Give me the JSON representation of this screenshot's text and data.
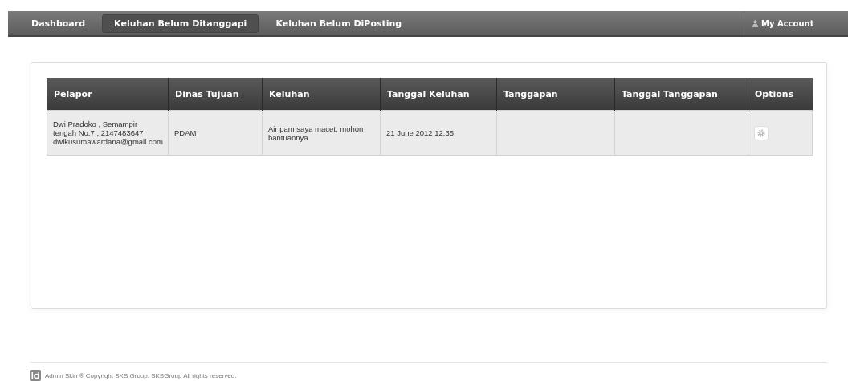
{
  "nav": {
    "tabs": [
      {
        "label": "Dashboard",
        "selected": false
      },
      {
        "label": "Keluhan Belum Ditanggapi",
        "selected": true
      },
      {
        "label": "Keluhan Belum DiPosting",
        "selected": false
      }
    ],
    "account": "My Account"
  },
  "table": {
    "columns": [
      "Pelapor",
      "Dinas Tujuan",
      "Keluhan",
      "Tanggal Keluhan",
      "Tanggapan",
      "Tanggal Tanggapan",
      "Options"
    ],
    "rows": [
      {
        "pelapor": "Dwi Pradoko , Semampir tengah No.7 , 2147483647 dwikusumawardana@gmail.com",
        "dinas_tujuan": "PDAM",
        "keluhan": "Air pam saya macet, mohon bantuannya",
        "tanggal_keluhan": "21 June 2012 12:35"
      }
    ]
  },
  "footer": "Admin Skin ® Copyright SKS Group. SKSGroup All rights reserved."
}
